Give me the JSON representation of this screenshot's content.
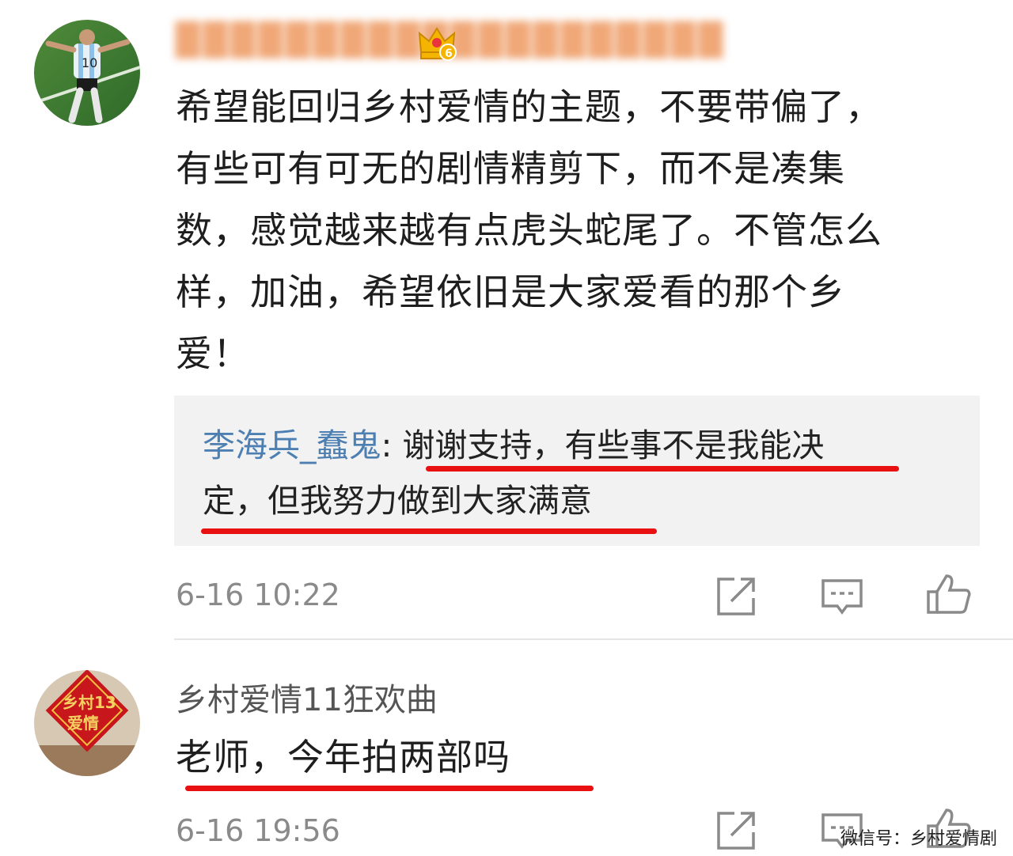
{
  "comments": [
    {
      "username": "████████████████████",
      "badge_level": "6",
      "lines": [
        "希望能回归乡村爱情的主题，不要带偏了，",
        "有些可有可无的剧情精剪下，而不是凑集",
        "数，感觉越来越有点虎头蛇尾了。不管怎么",
        "样，加油，希望依旧是大家爱看的那个乡",
        "爱！"
      ],
      "reply": {
        "author": "李海兵_蠢鬼",
        "separator": ": ",
        "line1": "谢谢支持，有些事不是我能决",
        "line2": "定，但我努力做到大家满意"
      },
      "timestamp": "6-16 10:22"
    },
    {
      "username": "乡村爱情11狂欢曲",
      "avatar_text": "乡村13爱情",
      "text": "老师，今年拍两部吗",
      "timestamp": "6-16 19:56"
    }
  ],
  "watermark": "微信号：乡村爱情剧",
  "colors": {
    "accent_link": "#4d7fb3",
    "underline": "#e81010",
    "reply_bg": "#f2f2f2"
  },
  "icons": [
    "share-icon",
    "comment-icon",
    "like-icon"
  ]
}
